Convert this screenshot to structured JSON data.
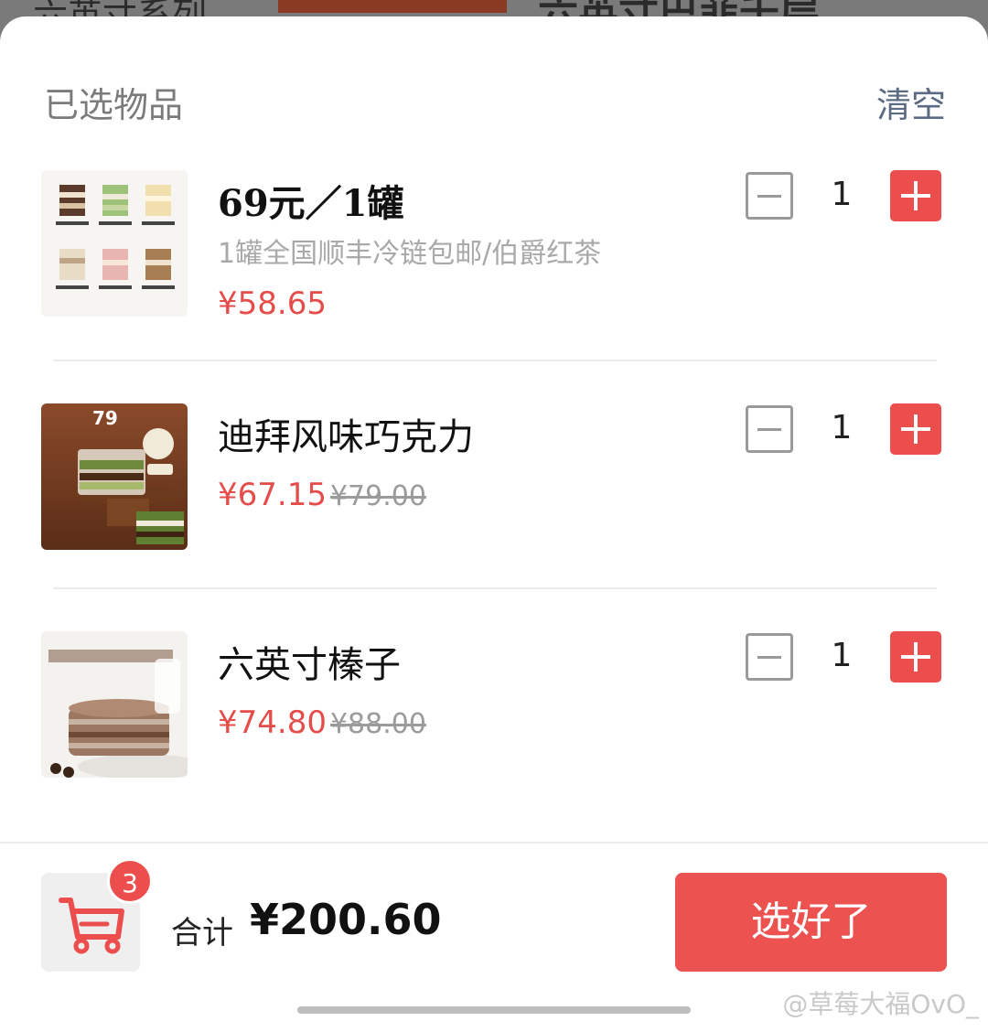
{
  "background": {
    "left_text": "六英寸系列",
    "right_text": "六英寸巴菲千层"
  },
  "sheet": {
    "title": "已选物品",
    "clear_label": "清空"
  },
  "items": [
    {
      "name": "69元／1罐",
      "spec": "1罐全国顺丰冷链包邮/伯爵红茶",
      "price": "¥58.65",
      "original_price": "",
      "quantity": "1"
    },
    {
      "name": "迪拜风味巧克力",
      "spec": "",
      "price": "¥67.15",
      "original_price": "¥79.00",
      "quantity": "1",
      "thumb_text": "79"
    },
    {
      "name": "六英寸榛子",
      "spec": "",
      "price": "¥74.80",
      "original_price": "¥88.00",
      "quantity": "1"
    }
  ],
  "footer": {
    "cart_count": "3",
    "total_label": "合计",
    "total_value": "¥200.60",
    "submit_label": "选好了"
  },
  "watermark": "@草莓大福OvO_",
  "colors": {
    "accent": "#eb4e4c",
    "price": "#e54d4a",
    "clear": "#5c6b84"
  }
}
